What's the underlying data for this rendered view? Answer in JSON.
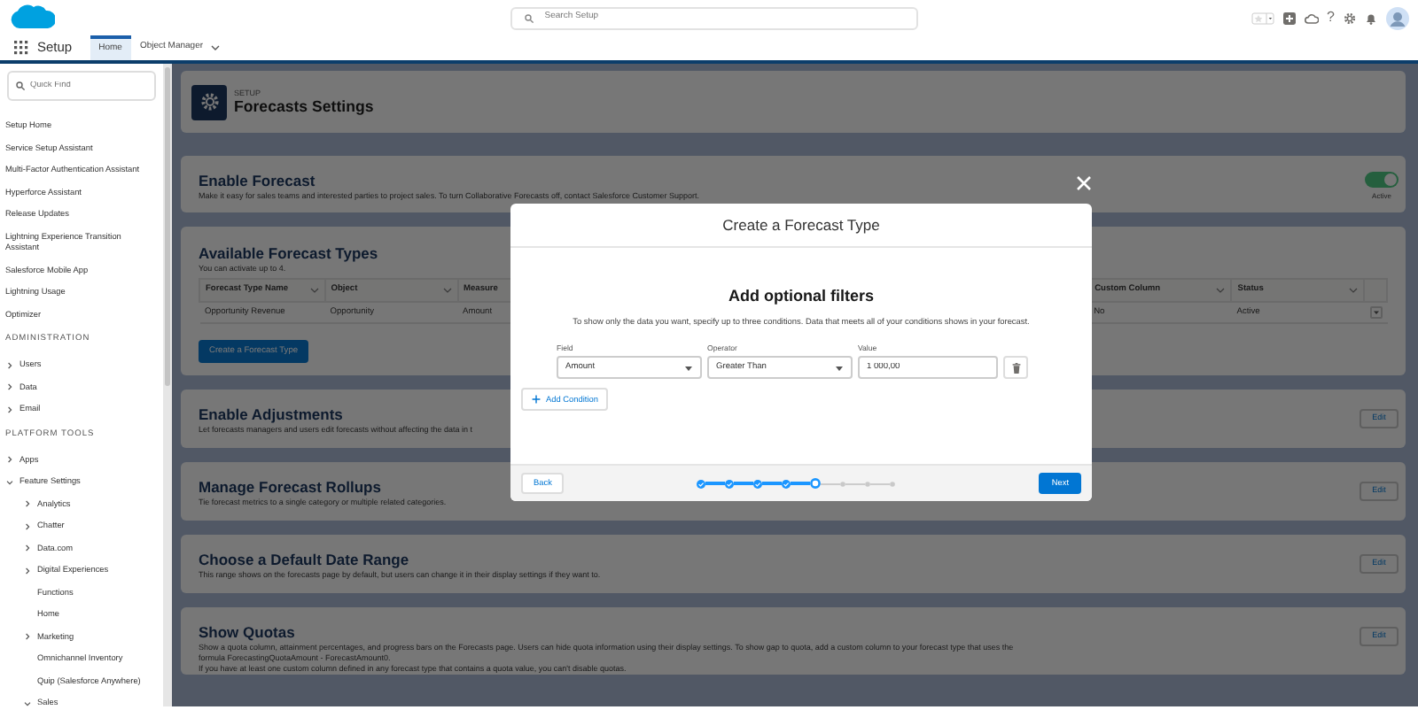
{
  "header": {
    "search_placeholder": "Search Setup",
    "help_icon": "?"
  },
  "nav": {
    "app_name": "Setup",
    "tabs": [
      {
        "label": "Home",
        "selected": true,
        "dropdown": false
      },
      {
        "label": "Object Manager",
        "selected": false,
        "dropdown": true
      }
    ]
  },
  "sidebar": {
    "quick_find_placeholder": "Quick Find",
    "items": [
      {
        "kind": "link",
        "label": "Setup Home"
      },
      {
        "kind": "link",
        "label": "Service Setup Assistant"
      },
      {
        "kind": "link",
        "label": "Multi-Factor Authentication Assistant"
      },
      {
        "kind": "link",
        "label": "Hyperforce Assistant"
      },
      {
        "kind": "link",
        "label": "Release Updates"
      },
      {
        "kind": "link",
        "label": "Lightning Experience Transition Assistant"
      },
      {
        "kind": "link",
        "label": "Salesforce Mobile App"
      },
      {
        "kind": "link",
        "label": "Lightning Usage"
      },
      {
        "kind": "link",
        "label": "Optimizer"
      },
      {
        "kind": "heading",
        "label": "ADMINISTRATION"
      },
      {
        "kind": "folder",
        "label": "Users",
        "expanded": false
      },
      {
        "kind": "folder",
        "label": "Data",
        "expanded": false
      },
      {
        "kind": "folder",
        "label": "Email",
        "expanded": false
      },
      {
        "kind": "heading",
        "label": "PLATFORM TOOLS"
      },
      {
        "kind": "folder",
        "label": "Apps",
        "expanded": false
      },
      {
        "kind": "folder",
        "label": "Feature Settings",
        "expanded": true,
        "children": [
          {
            "kind": "folder",
            "label": "Analytics",
            "expanded": false
          },
          {
            "kind": "folder",
            "label": "Chatter",
            "expanded": false
          },
          {
            "kind": "folder",
            "label": "Data.com",
            "expanded": false
          },
          {
            "kind": "folder",
            "label": "Digital Experiences",
            "expanded": false
          },
          {
            "kind": "link",
            "label": "Functions"
          },
          {
            "kind": "link",
            "label": "Home"
          },
          {
            "kind": "folder",
            "label": "Marketing",
            "expanded": false
          },
          {
            "kind": "link",
            "label": "Omnichannel Inventory"
          },
          {
            "kind": "link",
            "label": "Quip (Salesforce Anywhere)"
          },
          {
            "kind": "folder",
            "label": "Sales",
            "expanded": true
          }
        ]
      }
    ]
  },
  "page_header": {
    "eyebrow": "SETUP",
    "title": "Forecasts Settings"
  },
  "sections": [
    {
      "kind": "toggle",
      "title": "Enable Forecast",
      "description": [
        "Make it easy for sales teams and interested parties to project sales. To turn Collaborative Forecasts off, contact Salesforce Customer Support."
      ],
      "toggle": {
        "on": true,
        "label": "Active"
      }
    },
    {
      "kind": "table",
      "title": "Available Forecast Types",
      "description": [
        "You can activate up to 4."
      ],
      "columns": [
        "Forecast Type Name",
        "Object",
        "Measure",
        "Custom Column",
        "Status"
      ],
      "rows": [
        [
          "Opportunity Revenue",
          "Opportunity",
          "Amount",
          "No",
          "Active"
        ]
      ],
      "button": "Create a Forecast Type"
    },
    {
      "kind": "edit",
      "title": "Enable Adjustments",
      "description": [
        "Let forecasts managers and users edit forecasts without affecting the data in t"
      ],
      "button": "Edit"
    },
    {
      "kind": "edit",
      "title": "Manage Forecast Rollups",
      "description": [
        "Tie forecast metrics to a single category or multiple related categories."
      ],
      "button": "Edit"
    },
    {
      "kind": "edit",
      "title": "Choose a Default Date Range",
      "description": [
        "This range shows on the forecasts page by default, but users can change it in their display settings if they want to."
      ],
      "button": "Edit"
    },
    {
      "kind": "edit",
      "title": "Show Quotas",
      "description": [
        "Show a quota column, attainment percentages, and progress bars on the Forecasts page. Users can hide quota information using their display settings. To show gap to quota, add a custom column to your forecast type that uses the formula ForecastingQuotaAmount - ForecastAmount0.",
        "If you have at least one custom column defined in any forecast type that contains a quota value, you can't disable quotas."
      ],
      "button": "Edit"
    }
  ],
  "modal": {
    "title": "Create a Forecast Type",
    "heading": "Add optional filters",
    "description": "To show only the data you want, specify up to three conditions. Data that meets all of your conditions shows in your forecast.",
    "labels": [
      "Field",
      "Operator",
      "Value"
    ],
    "conditions": [
      {
        "field": "Amount",
        "operator": "Greater Than",
        "value": "1 000,00"
      }
    ],
    "add_condition": "Add Condition",
    "back": "Back",
    "next": "Next",
    "steps": [
      {
        "completed": true,
        "current": false
      },
      {
        "completed": true,
        "current": false
      },
      {
        "completed": true,
        "current": false
      },
      {
        "completed": true,
        "current": false
      },
      {
        "completed": false,
        "current": true
      },
      {
        "completed": false,
        "current": false
      },
      {
        "completed": false,
        "current": false
      },
      {
        "completed": false,
        "current": false
      }
    ]
  }
}
